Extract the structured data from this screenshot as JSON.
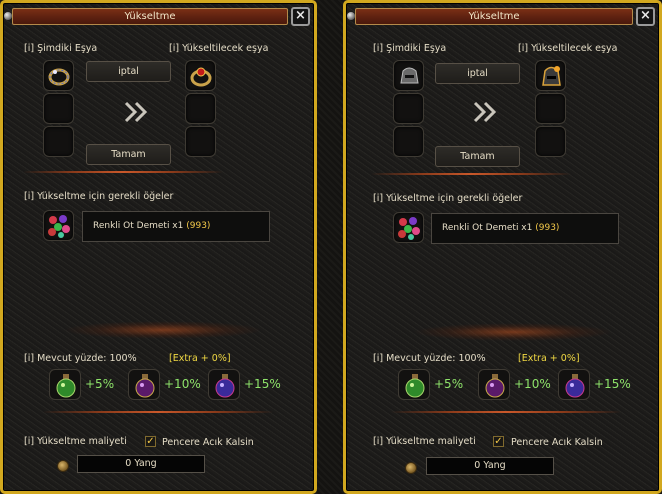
{
  "windows": [
    {
      "title": "Yükseltme",
      "close_icon": "×",
      "current_item_label": "[i] Şimdiki Eşya",
      "upgraded_item_label": "[i] Yükseltilecek eşya",
      "cancel_label": "iptal",
      "confirm_label": "Tamam",
      "required_items_label": "[i] Yükseltme için gerekli öğeler",
      "required_item_name": "Renkli Ot Demeti x1",
      "required_item_count": "(993)",
      "current_rate_label": "[i] Mevcut yüzde: 100%",
      "extra_label": "[Extra + 0%]",
      "potions": [
        "+5%",
        "+10%",
        "+15%"
      ],
      "cost_label": "[i] Yükseltme maliyeti",
      "keep_open_label": "Pencere Acık Kalsin",
      "keep_open_checked": true,
      "cost_value": "0 Yang",
      "current_item_icon": "ring-icon",
      "upgraded_item_icon": "ring-ruby-icon"
    },
    {
      "title": "Yükseltme",
      "close_icon": "×",
      "current_item_label": "[i] Şimdiki Eşya",
      "upgraded_item_label": "[i] Yükseltilecek eşya",
      "cancel_label": "iptal",
      "confirm_label": "Tamam",
      "required_items_label": "[i] Yükseltme için gerekli öğeler",
      "required_item_name": "Renkli Ot Demeti x1",
      "required_item_count": "(993)",
      "current_rate_label": "[i] Mevcut yüzde: 100%",
      "extra_label": "[Extra + 0%]",
      "potions": [
        "+5%",
        "+10%",
        "+15%"
      ],
      "cost_label": "[i] Yükseltme maliyeti",
      "keep_open_label": "Pencere Acık Kalsin",
      "keep_open_checked": true,
      "cost_value": "0 Yang",
      "current_item_icon": "helmet-icon",
      "upgraded_item_icon": "helmet-gold-icon"
    }
  ],
  "colors": {
    "frame": "#d2a81f",
    "title_bar": "#5b2010",
    "highlight": "#f3c94a",
    "percent": "#8ee36a"
  }
}
